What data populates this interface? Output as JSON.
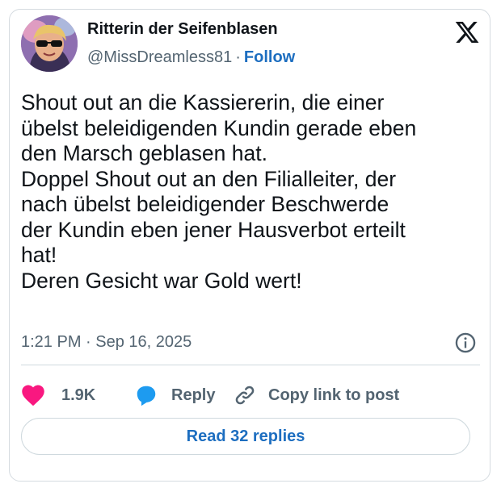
{
  "author": {
    "display_name": "Ritterin der Seifenblasen",
    "handle": "@MissDreamless81",
    "separator": "·",
    "follow_label": "Follow",
    "avatar_icon": "avatar-photo"
  },
  "platform_icon": "x-logo-icon",
  "tweet": {
    "lines": [
      "Shout out an die Kassiererin, die einer",
      "übelst beleidigenden Kundin gerade eben",
      "den Marsch geblasen hat.",
      "Doppel Shout out an den Filialleiter, der",
      "nach übelst beleidigender Beschwerde",
      "der Kundin eben jener Hausverbot erteilt",
      "hat!",
      "Deren Gesicht war Gold wert!"
    ],
    "timestamp": "1:21 PM · Sep 16, 2025"
  },
  "actions": {
    "like_count": "1.9K",
    "reply_label": "Reply",
    "copy_label": "Copy link to post"
  },
  "read_replies_label": "Read 32 replies",
  "colors": {
    "accent": "#1d6ec0",
    "like": "#f91880",
    "reply_icon": "#1d9bf0",
    "muted_text": "#536471",
    "border": "#cfd9de"
  }
}
